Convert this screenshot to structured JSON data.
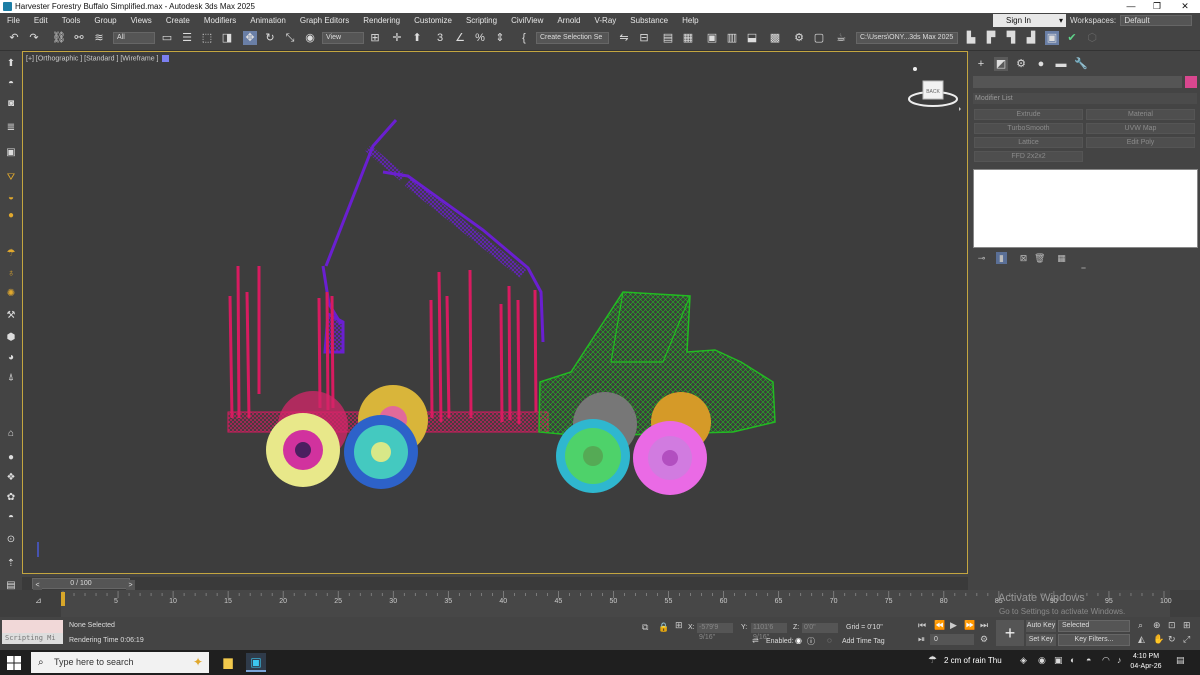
{
  "window": {
    "title": "Harvester Forestry Buffalo Simplified.max - Autodesk 3ds Max 2025",
    "minimize": "—",
    "maximize": "❐",
    "close": "✕"
  },
  "menu": [
    "File",
    "Edit",
    "Tools",
    "Group",
    "Views",
    "Create",
    "Modifiers",
    "Animation",
    "Graph Editors",
    "Rendering",
    "Customize",
    "Scripting",
    "CivilView",
    "Arnold",
    "V-Ray",
    "Substance",
    "Help"
  ],
  "account": {
    "signin_label": "Sign In",
    "workspaces_label": "Workspaces:",
    "workspace_value": "Default"
  },
  "toolbar": {
    "selection_filter": "All",
    "ref_coord": "View",
    "named_selection": "Create Selection Se",
    "project_path": "C:\\Users\\ONY...3ds Max 2025"
  },
  "viewport": {
    "label": "[+] [Orthographic ] [Standard ] [Wireframe ]",
    "viewcube_face": "BACK"
  },
  "command_panel": {
    "modifier_list": "Modifier List",
    "modifier_buttons": [
      "Extrude",
      "Material",
      "TurboSmooth",
      "UVW Map",
      "Lattice",
      "Edit Poly",
      "FFD 2x2x2"
    ]
  },
  "time_slider": {
    "range_label": "0 / 100",
    "prev": "<",
    "next": ">"
  },
  "track_ticks": [
    "5",
    "10",
    "15",
    "20",
    "25",
    "30",
    "35",
    "40",
    "45",
    "50",
    "55",
    "60",
    "65",
    "70",
    "75",
    "80",
    "85",
    "90",
    "95",
    "100"
  ],
  "watermark": {
    "title": "Activate Windows",
    "subtitle": "Go to Settings to activate Windows."
  },
  "status": {
    "listener_label": "",
    "listener_prompt": "Scripting Mi",
    "selection": "None Selected",
    "render_time": "Rendering Time  0:06:19",
    "x_label": "X:",
    "x_value": "-579'9 9/16\"",
    "y_label": "Y:",
    "y_value": "1101'6 9/16\"",
    "z_label": "Z:",
    "z_value": "0'0\"",
    "grid": "Grid = 0'10\"",
    "enabled_label": "Enabled:",
    "add_time_tag": "Add Time Tag",
    "auto_key": "Auto Key",
    "set_key": "Set Key",
    "selected_set": "Selected",
    "key_filters": "Key Filters...",
    "current_frame": "0"
  },
  "taskbar": {
    "search_placeholder": "Type here to search",
    "weather": "2 cm of rain Thu",
    "time": "4:10 PM",
    "date": "04-Apr-26"
  }
}
